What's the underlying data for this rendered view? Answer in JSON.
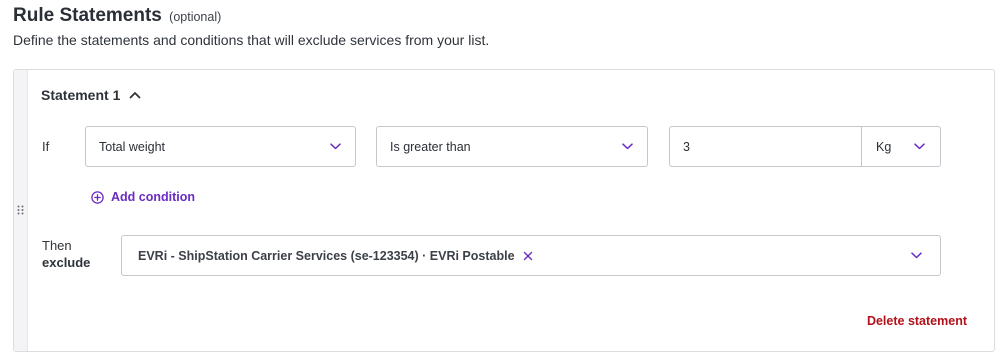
{
  "section": {
    "title": "Rule Statements",
    "optional_label": "(optional)",
    "description": "Define the statements and conditions that will exclude services from your list."
  },
  "statement": {
    "title": "Statement 1",
    "if_label": "If",
    "field_value": "Total weight",
    "operator_value": "Is greater than",
    "amount_value": "3",
    "unit_value": "Kg",
    "add_condition_label": "Add condition",
    "then_label": "Then",
    "then_action_label": "exclude",
    "selected_services": [
      "EVRi - ShipStation Carrier Services (se-123354) · EVRi Postable"
    ],
    "delete_label": "Delete statement"
  },
  "colors": {
    "accent": "#6a2bc3",
    "danger": "#b3111a",
    "border": "#c5c7cc"
  },
  "icons": [
    "drag-handle-icon",
    "chevron-up-icon",
    "chevron-down-icon",
    "plus-circle-icon",
    "close-icon"
  ]
}
